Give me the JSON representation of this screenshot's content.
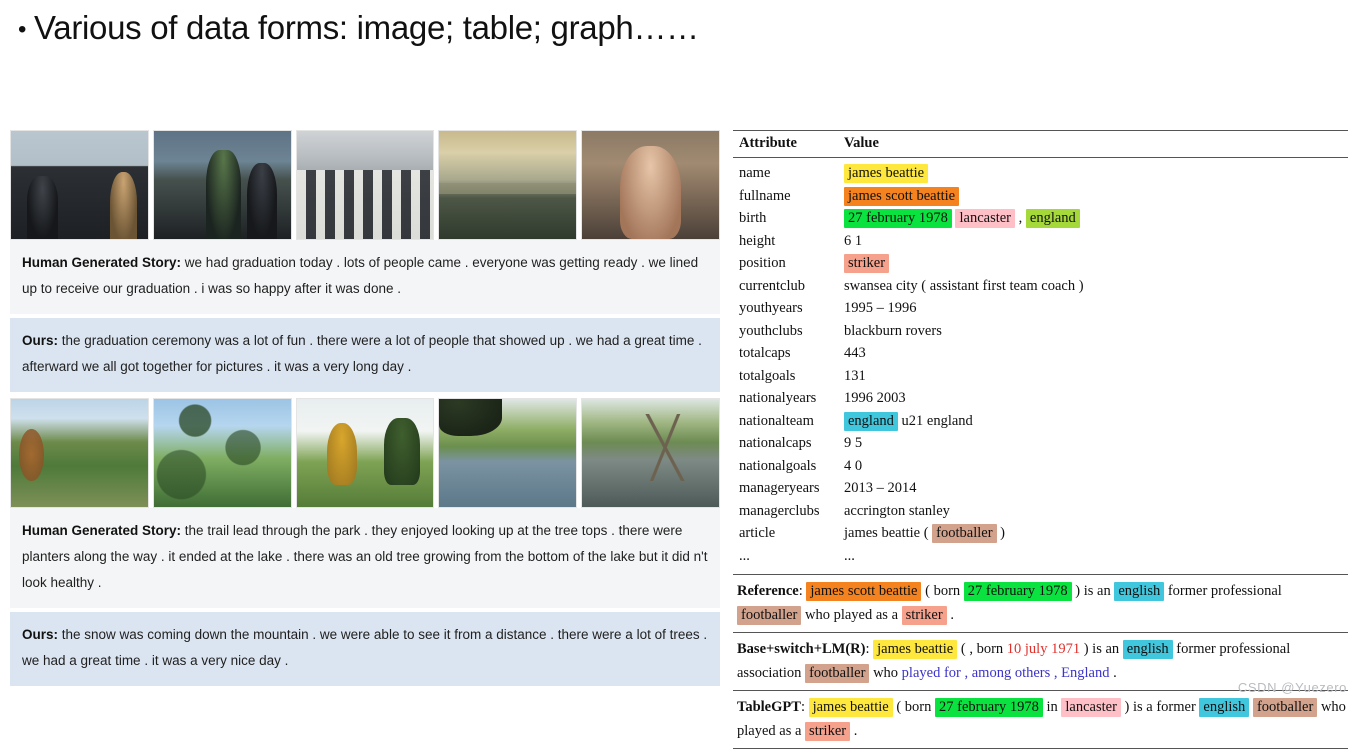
{
  "slide": {
    "bullet": "•",
    "title": "Various of data forms: image; table; graph……"
  },
  "left_panel": {
    "examples": [
      {
        "photos": [
          "graduation-crowd-photo",
          "graduation-ceremony-photo",
          "graduation-gowns-photo",
          "outdoor-field-sunset-photo",
          "woman-smiling-photo"
        ],
        "human_label": "Human Generated Story:",
        "human_text": " we had graduation today . lots of people came . everyone was getting ready . we lined up to receive our graduation . i was so happy after it was done .",
        "ours_label": "Ours:",
        "ours_text": " the graduation ceremony was a lot of fun . there were a lot of people that showed up . we had a great time . afterward we all got together for pictures . it was a very long day ."
      },
      {
        "photos": [
          "park-autumn-trees-photo",
          "tree-canopy-sky-photo",
          "park-yellow-tree-photo",
          "lake-shoreline-photo",
          "lake-bare-branch-photo"
        ],
        "human_label": "Human Generated Story:",
        "human_text": " the trail lead through the park . they enjoyed looking up at the tree tops . there were  planters along the way . it ended at the lake . there was an old tree growing from the bottom of the lake but it did n't look healthy .",
        "ours_label": "Ours:",
        "ours_text": " the snow was coming down the mountain . we were able to see it from a distance . there were a lot of trees . we had a great time . it was a very nice day ."
      }
    ]
  },
  "right_panel": {
    "table": {
      "headers": [
        "Attribute",
        "Value"
      ],
      "rows": [
        {
          "attribute": "name",
          "value_parts": [
            {
              "text": "james beattie",
              "style": "hl-yellow"
            }
          ]
        },
        {
          "attribute": "fullname",
          "value_parts": [
            {
              "text": "james scott beattie",
              "style": "hl-orange"
            }
          ]
        },
        {
          "attribute": "birth",
          "value_parts": [
            {
              "text": "27 february 1978",
              "style": "hl-green"
            },
            {
              "text": " ",
              "style": ""
            },
            {
              "text": "lancaster",
              "style": "hl-pink"
            },
            {
              "text": " , ",
              "style": ""
            },
            {
              "text": "england",
              "style": "hl-ygreen"
            }
          ]
        },
        {
          "attribute": "height",
          "value_parts": [
            {
              "text": "6 1",
              "style": ""
            }
          ]
        },
        {
          "attribute": "position",
          "value_parts": [
            {
              "text": "striker",
              "style": "hl-salmon"
            }
          ]
        },
        {
          "attribute": "currentclub",
          "value_parts": [
            {
              "text": "swansea city ( assistant first team coach )",
              "style": ""
            }
          ]
        },
        {
          "attribute": "youthyears",
          "value_parts": [
            {
              "text": "1995 – 1996",
              "style": ""
            }
          ]
        },
        {
          "attribute": "youthclubs",
          "value_parts": [
            {
              "text": "blackburn rovers",
              "style": ""
            }
          ]
        },
        {
          "attribute": "totalcaps",
          "value_parts": [
            {
              "text": "443",
              "style": ""
            }
          ]
        },
        {
          "attribute": "totalgoals",
          "value_parts": [
            {
              "text": "131",
              "style": ""
            }
          ]
        },
        {
          "attribute": "nationalyears",
          "value_parts": [
            {
              "text": "1996 2003",
              "style": ""
            }
          ]
        },
        {
          "attribute": "nationalteam",
          "value_parts": [
            {
              "text": "england",
              "style": "hl-cyan"
            },
            {
              "text": " u21 england",
              "style": ""
            }
          ]
        },
        {
          "attribute": "nationalcaps",
          "value_parts": [
            {
              "text": "9 5",
              "style": ""
            }
          ]
        },
        {
          "attribute": "nationalgoals",
          "value_parts": [
            {
              "text": "4 0",
              "style": ""
            }
          ]
        },
        {
          "attribute": "manageryears",
          "value_parts": [
            {
              "text": "2013 – 2014",
              "style": ""
            }
          ]
        },
        {
          "attribute": "managerclubs",
          "value_parts": [
            {
              "text": "accrington stanley",
              "style": ""
            }
          ]
        },
        {
          "attribute": "article",
          "value_parts": [
            {
              "text": "james beattie ( ",
              "style": ""
            },
            {
              "text": "footballer",
              "style": "hl-tan"
            },
            {
              "text": " )",
              "style": ""
            }
          ]
        },
        {
          "attribute": "...",
          "value_parts": [
            {
              "text": "...",
              "style": ""
            }
          ]
        }
      ]
    },
    "generations": [
      {
        "label": "Reference",
        "parts": [
          {
            "text": ": ",
            "style": ""
          },
          {
            "text": "james scott beattie",
            "style": "hl-orange"
          },
          {
            "text": " ( born ",
            "style": ""
          },
          {
            "text": "27 february 1978",
            "style": "hl-green"
          },
          {
            "text": " ) is an ",
            "style": ""
          },
          {
            "text": "english",
            "style": "hl-cyan"
          },
          {
            "text": " former professional ",
            "style": ""
          },
          {
            "text": "footballer",
            "style": "hl-tan"
          },
          {
            "text": " who played as a ",
            "style": ""
          },
          {
            "text": "striker",
            "style": "hl-salmon"
          },
          {
            "text": " .",
            "style": ""
          }
        ]
      },
      {
        "label": "Base+switch+LM(R)",
        "parts": [
          {
            "text": ": ",
            "style": ""
          },
          {
            "text": "james beattie",
            "style": "hl-yellow"
          },
          {
            "text": " ( , born ",
            "style": ""
          },
          {
            "text": "10 july 1971",
            "style": "txt-red"
          },
          {
            "text": " ) is an ",
            "style": ""
          },
          {
            "text": "english",
            "style": "hl-cyan"
          },
          {
            "text": " former professional association ",
            "style": ""
          },
          {
            "text": "footballer",
            "style": "hl-tan"
          },
          {
            "text": " who ",
            "style": ""
          },
          {
            "text": "played for , among others , England",
            "style": "txt-blue"
          },
          {
            "text": " .",
            "style": ""
          }
        ]
      },
      {
        "label": "TableGPT",
        "parts": [
          {
            "text": ": ",
            "style": ""
          },
          {
            "text": "james beattie",
            "style": "hl-yellow"
          },
          {
            "text": " ( born ",
            "style": ""
          },
          {
            "text": "27 february 1978",
            "style": "hl-green"
          },
          {
            "text": " in ",
            "style": ""
          },
          {
            "text": "lancaster",
            "style": "hl-pink"
          },
          {
            "text": " ) is a former ",
            "style": ""
          },
          {
            "text": "english",
            "style": "hl-cyan"
          },
          {
            "text": " ",
            "style": ""
          },
          {
            "text": "footballer",
            "style": "hl-tan"
          },
          {
            "text": " who played as a ",
            "style": ""
          },
          {
            "text": "striker",
            "style": "hl-salmon"
          },
          {
            "text": " .",
            "style": ""
          }
        ]
      }
    ]
  },
  "watermark": "CSDN @Yuezero",
  "colors": {
    "highlight_yellow": "#ffe83d",
    "highlight_orange": "#f4821f",
    "highlight_green": "#0ae23f",
    "highlight_pink": "#ffbfc6",
    "highlight_yellow_green": "#a5d93a",
    "highlight_salmon": "#f6a18c",
    "highlight_cyan": "#41c7dd",
    "highlight_tan": "#d3a28c",
    "text_red": "#e0312c",
    "text_blue": "#3c33c8",
    "ours_background": "#dbe5f1",
    "human_background": "#f4f5f6"
  }
}
